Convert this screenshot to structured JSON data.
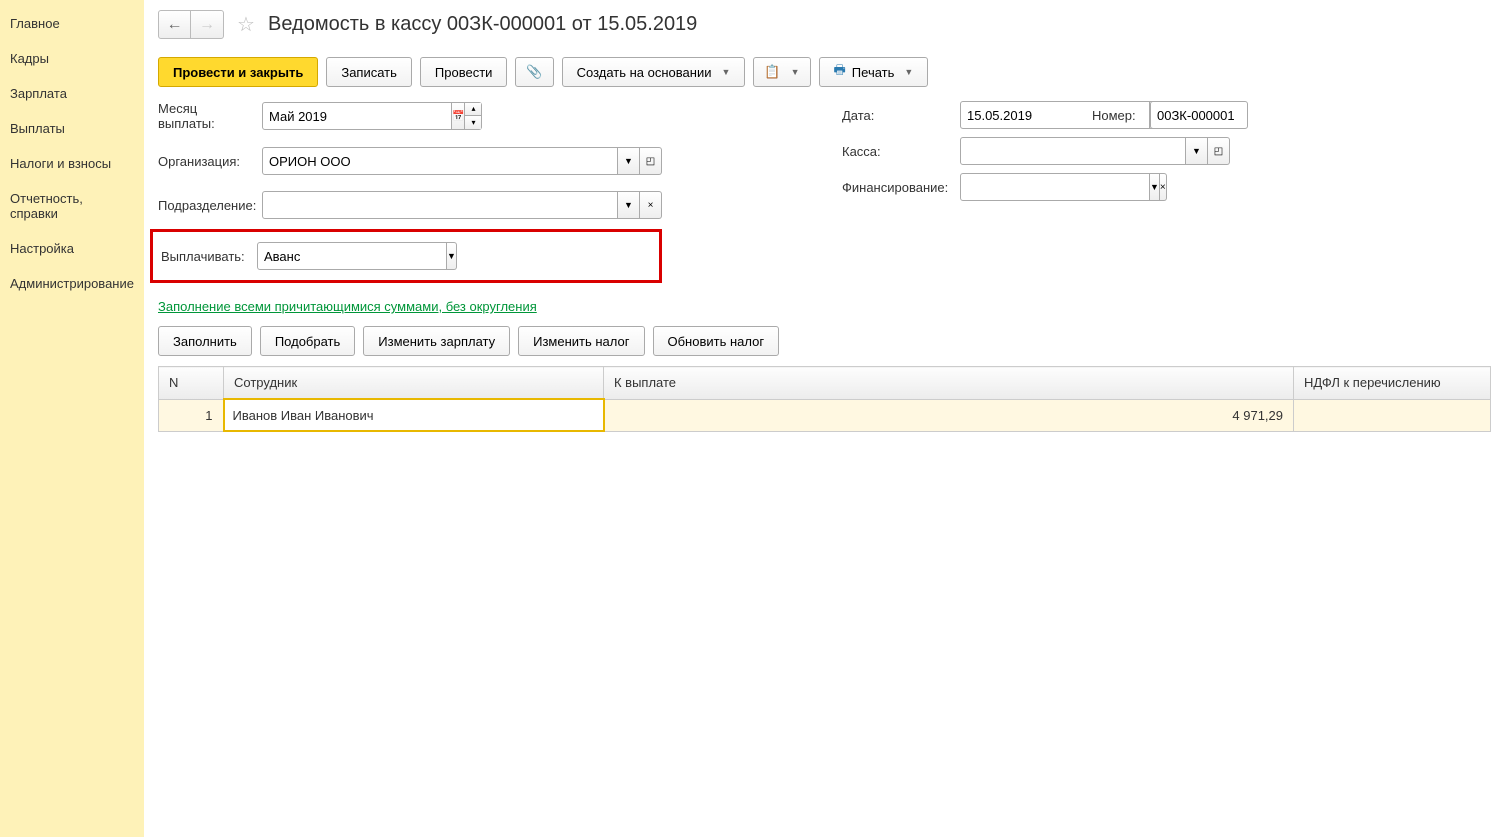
{
  "sidebar": {
    "items": [
      "Главное",
      "Кадры",
      "Зарплата",
      "Выплаты",
      "Налоги и взносы",
      "Отчетность, справки",
      "Настройка",
      "Администрирование"
    ]
  },
  "header": {
    "title": "Ведомость в кассу 00ЗК-000001 от 15.05.2019"
  },
  "toolbar": {
    "post_close": "Провести и закрыть",
    "save": "Записать",
    "post": "Провести",
    "create_based": "Создать на основании",
    "print": "Печать"
  },
  "form": {
    "month_label": "Месяц выплаты:",
    "month_value": "Май 2019",
    "org_label": "Организация:",
    "org_value": "ОРИОН ООО",
    "dept_label": "Подразделение:",
    "dept_value": "",
    "pay_label": "Выплачивать:",
    "pay_value": "Аванс",
    "date_label": "Дата:",
    "date_value": "15.05.2019",
    "number_label": "Номер:",
    "number_value": "00ЗК-000001",
    "cash_label": "Касса:",
    "cash_value": "",
    "fin_label": "Финансирование:",
    "fin_value": ""
  },
  "link_text": "Заполнение всеми причитающимися суммами, без округления",
  "actions": {
    "fill": "Заполнить",
    "select": "Подобрать",
    "change_salary": "Изменить зарплату",
    "change_tax": "Изменить налог",
    "update_tax": "Обновить налог"
  },
  "table": {
    "headers": {
      "n": "N",
      "employee": "Сотрудник",
      "to_pay": "К выплате",
      "ndfl": "НДФЛ к перечислению"
    },
    "rows": [
      {
        "n": "1",
        "employee": "Иванов Иван Иванович",
        "to_pay": "4 971,29",
        "ndfl": ""
      }
    ]
  }
}
